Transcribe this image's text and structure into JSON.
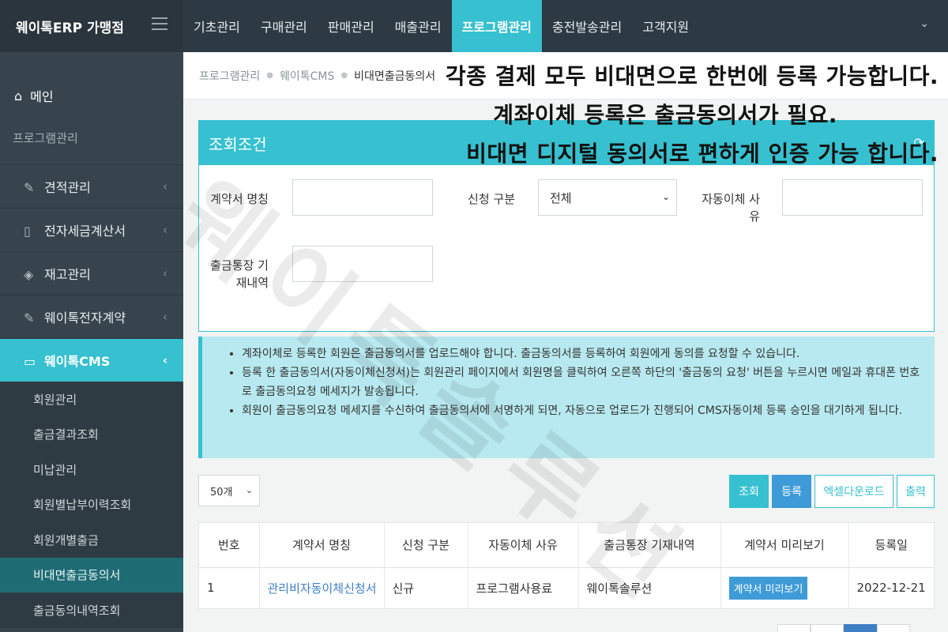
{
  "brand": "웨이톡ERP 가맹점",
  "topnav": [
    "기초관리",
    "구매관리",
    "판매관리",
    "매출관리",
    "프로그램관리",
    "충전발송관리",
    "고객지원"
  ],
  "topnav_active": 4,
  "sidebar": {
    "main_label": "메인",
    "section_label": "프로그램관리",
    "items": [
      {
        "label": "견적관리",
        "icon": "edit-icon"
      },
      {
        "label": "전자세금계산서",
        "icon": "phone-icon"
      },
      {
        "label": "재고관리",
        "icon": "layers-icon"
      },
      {
        "label": "웨이톡전자계약",
        "icon": "edit-icon"
      },
      {
        "label": "웨이톡CMS",
        "icon": "card-icon"
      }
    ],
    "sub_items": [
      "회원관리",
      "출금결과조회",
      "미납관리",
      "회원별납부이력조회",
      "회원개별출금",
      "비대면출금동의서",
      "출금동의내역조회"
    ]
  },
  "breadcrumb": [
    "프로그램관리",
    "웨이톡CMS",
    "비대면출금동의서"
  ],
  "overlay": [
    "각종 결제 모두 비대면으로 한번에 등록 가능합니다.",
    "계좌이체 등록은 출금동의서가 필요.",
    "비대면 디지털 동의서로 편하게 인증 가능 합니다."
  ],
  "panel": {
    "title": "조회조건",
    "labels": {
      "contract_name": "계약서 명칭",
      "apply_type": "신청 구분",
      "auto_reason_1": "자동이체 사",
      "auto_reason_2": "유",
      "bank_memo_1": "출금통장 기",
      "bank_memo_2": "재내역"
    },
    "apply_type_value": "전체"
  },
  "info": [
    "계좌이체로 등록한 회원은 출금동의서를 업로드해야 합니다. 출금동의서를 등록하여 회원에게 동의를 요청할 수 있습니다.",
    "등록 한 출금동의서(자동이체신청서)는 회원관리 페이지에서 회원명을 클릭하여 오른쪽 하단의 '출금동의 요청' 버튼을 누르시면 메일과 휴대폰 번호로 출금동의요청 메세지가 발송됩니다.",
    "회원이 출금동의요청 메세지를 수신하여 출금동의서에 서명하게 되면, 자동으로 업로드가 진행되어 CMS자동이체 등록 승인을 대기하게 됩니다."
  ],
  "controls": {
    "page_size": "50개",
    "search": "조회",
    "register": "등록",
    "excel": "엑셀다운로드",
    "print": "출력"
  },
  "table": {
    "headers": [
      "번호",
      "계약서 명칭",
      "신청 구분",
      "자동이체 사유",
      "출금통장 기재내역",
      "계약서 미리보기",
      "등록일"
    ],
    "rows": [
      {
        "no": "1",
        "name": "관리비자동이체신청서",
        "type": "신규",
        "reason": "프로그램사용료",
        "memo": "웨이톡솔루션",
        "preview": "계약서 미리보기",
        "date": "2022-12-21"
      }
    ]
  },
  "watermark": "웨이톡솔루션"
}
